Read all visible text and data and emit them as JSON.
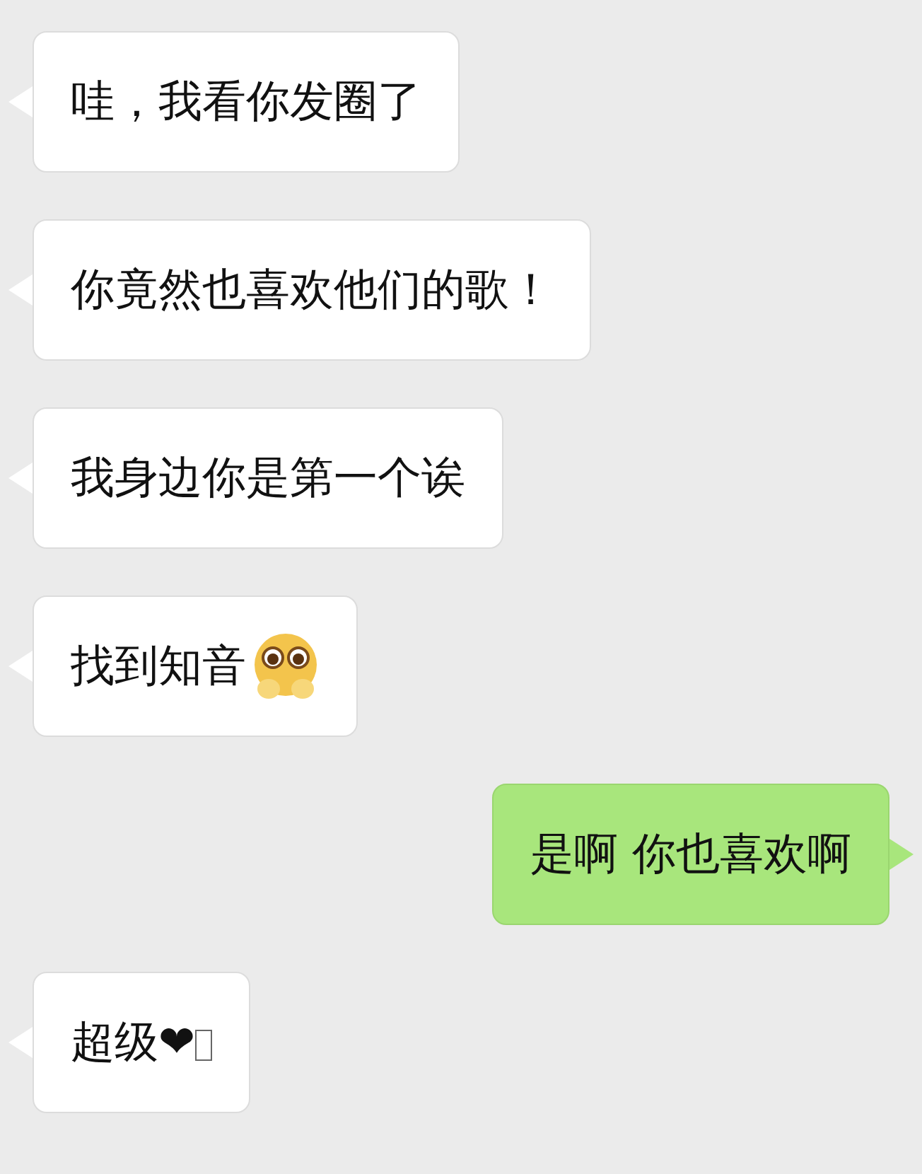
{
  "messages": [
    {
      "kind": "incoming",
      "parts": [
        {
          "kind": "text",
          "text": "哇，我看你发圈了"
        }
      ]
    },
    {
      "kind": "incoming",
      "parts": [
        {
          "kind": "text",
          "text": "你竟然也喜欢他们的歌！"
        }
      ]
    },
    {
      "kind": "incoming",
      "parts": [
        {
          "kind": "text",
          "text": "我身边你是第一个诶"
        }
      ]
    },
    {
      "kind": "incoming",
      "parts": [
        {
          "kind": "text",
          "text": "找到知音"
        },
        {
          "kind": "emoji"
        }
      ]
    },
    {
      "kind": "outgoing",
      "parts": [
        {
          "kind": "text",
          "text": "是啊 你也喜欢啊"
        }
      ]
    },
    {
      "kind": "incoming",
      "parts": [
        {
          "kind": "text",
          "text": "超级❤"
        },
        {
          "kind": "missing_glyph"
        }
      ]
    }
  ]
}
